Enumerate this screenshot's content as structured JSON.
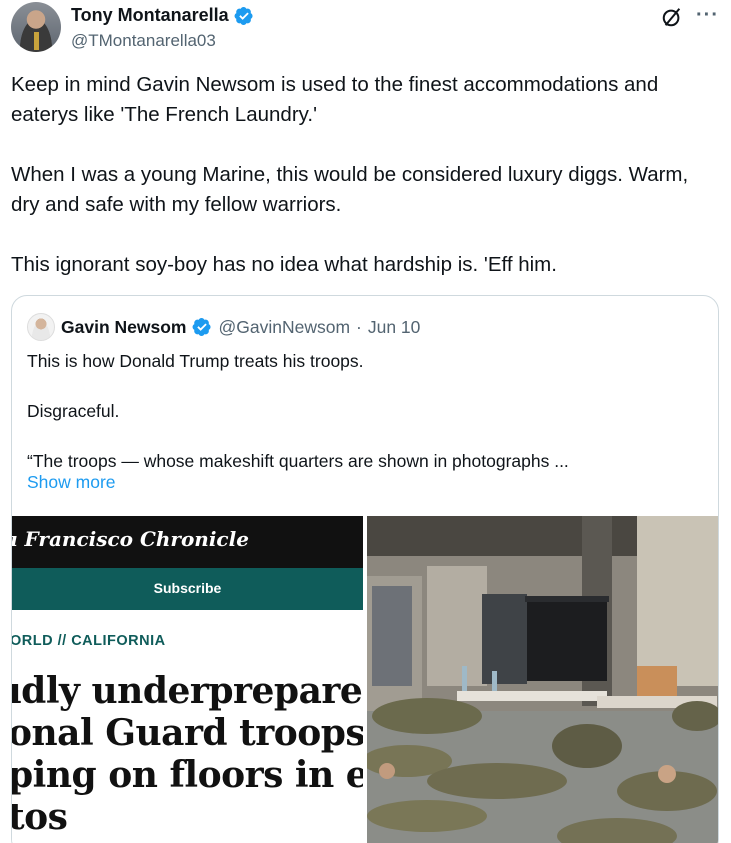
{
  "author": {
    "name": "Tony Montanarella",
    "handle": "@TMontanarella03",
    "verified": true
  },
  "post": {
    "paragraphs": [
      "Keep in mind Gavin Newsom is used to the finest accommodations and eaterys like 'The French Laundry.'",
      "When I was a young Marine, this would be considered luxury diggs. Warm, dry and safe with my fellow warriors.",
      "This ignorant soy-boy has no idea what hardship is. 'Eff him."
    ]
  },
  "quoted": {
    "name": "Gavin Newsom",
    "handle": "@GavinNewsom",
    "separator": "·",
    "date": "Jun 10",
    "paragraphs": [
      "This is how Donald Trump treats his troops.",
      "Disgraceful.",
      "“The troops — whose makeshift quarters are shown in photographs ..."
    ],
    "show_more": "Show more",
    "image_left": {
      "masthead": "ı Francisco Chronicle",
      "subscribe": "Subscribe",
      "section": "ORLD // CALIFORNIA",
      "headline_lines": [
        "ıdly underprepared’:",
        "onal Guard troops see",
        "ping on floors in exclus",
        "tos"
      ]
    }
  },
  "icons": {
    "verified": "verified-badge-icon",
    "grok": "grok-icon",
    "more": "more-options-icon"
  },
  "colors": {
    "verified": "#1d9bf0",
    "link": "#1d9bf0",
    "secondary_text": "#536471",
    "chronicle_teal": "#0f5c5a"
  }
}
